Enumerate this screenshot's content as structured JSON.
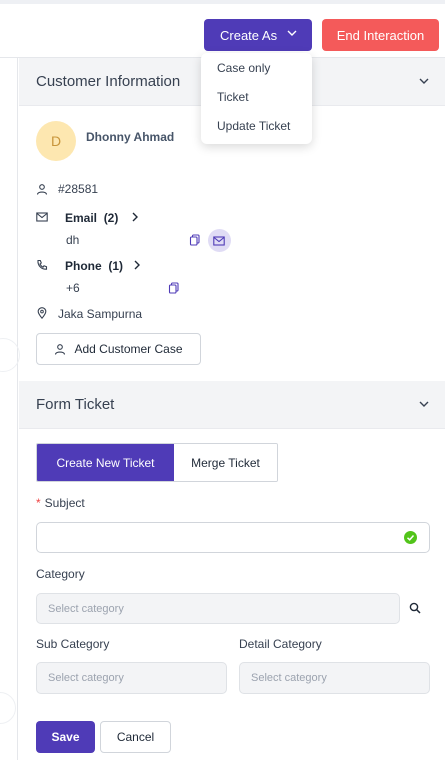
{
  "header": {
    "create_as_label": "Create As",
    "end_interaction_label": "End Interaction"
  },
  "create_as_menu": {
    "items": [
      {
        "label": "Case only"
      },
      {
        "label": "Ticket"
      },
      {
        "label": "Update Ticket"
      }
    ]
  },
  "customer_info": {
    "panel_title": "Customer Information",
    "avatar_initial": "D",
    "name": "Dhonny Ahmad",
    "id": "#28581",
    "email_label": "Email",
    "email_count": "(2)",
    "email_value": "dh",
    "phone_label": "Phone",
    "phone_count": "(1)",
    "phone_value": "+6",
    "address": "Jaka Sampurna",
    "add_case_label": "Add Customer Case"
  },
  "form_ticket": {
    "panel_title": "Form Ticket",
    "tab_create": "Create New Ticket",
    "tab_merge": "Merge Ticket",
    "required_mark": "*",
    "subject_label": "Subject",
    "subject_value": "",
    "category_label": "Category",
    "category_placeholder": "Select category",
    "sub_category_label": "Sub Category",
    "sub_category_placeholder": "Select category",
    "detail_category_label": "Detail Category",
    "detail_category_placeholder": "Select category",
    "save_label": "Save",
    "cancel_label": "Cancel"
  },
  "colors": {
    "primary": "#4f3bb7",
    "danger": "#f45a5a",
    "success": "#52c41a",
    "avatar_bg": "#fde7b0"
  }
}
